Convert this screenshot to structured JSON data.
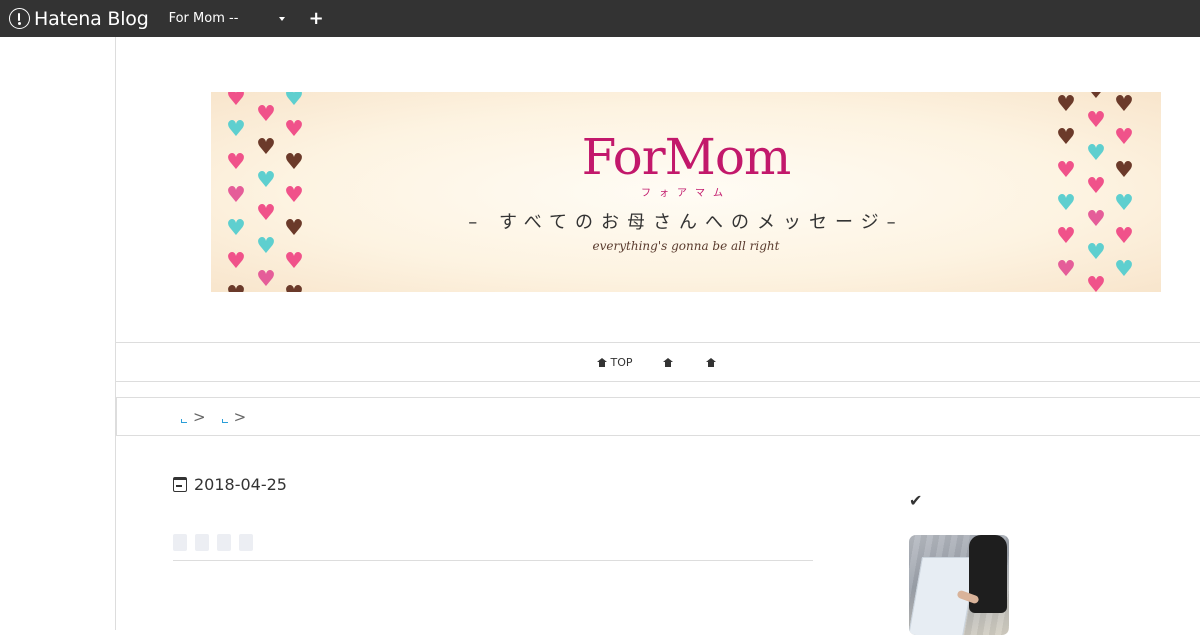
{
  "topbar": {
    "logo_text": "Hatena Blog",
    "blog_select": "For Mom --",
    "add_label": "+"
  },
  "banner": {
    "title": "ForMom",
    "kana": "フォアマム",
    "subtitle": "– すべてのお母さんへのメッセージ–",
    "tagline": "everything's gonna be all right",
    "colors": {
      "pink": "#f0528a",
      "brown": "#6b3a2a",
      "teal": "#5ecfcf",
      "title": "#c2186b"
    }
  },
  "nav": {
    "items": [
      {
        "label": "TOP",
        "icon": "home-icon"
      },
      {
        "label": "",
        "icon": "home-icon"
      },
      {
        "label": "",
        "icon": "home-icon"
      }
    ]
  },
  "breadcrumb": {
    "separator": ">"
  },
  "article": {
    "date": "2018-04-25"
  },
  "sidebar": {
    "check_icon": "✔"
  }
}
